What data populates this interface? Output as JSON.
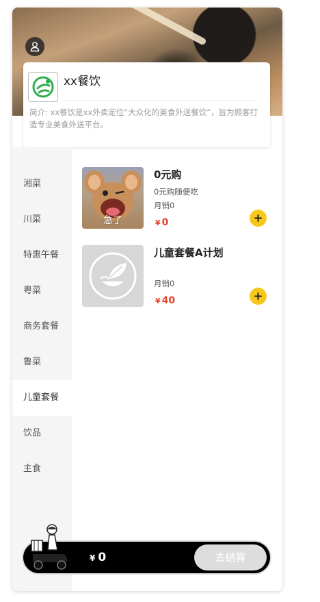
{
  "shop": {
    "name": "xx餐饮",
    "intro": "简介: xx餐饮是xx外卖定位“大众化的美食外送餐饮”，旨为顾客打造专业美食外送平台。"
  },
  "categories": [
    "湘菜",
    "川菜",
    "特惠午餐",
    "粤菜",
    "商务套餐",
    "鲁菜",
    "儿童套餐",
    "饮品",
    "主食"
  ],
  "active_category": "儿童套餐",
  "items": [
    {
      "name": "0元购",
      "desc": "0元购随便吃",
      "sales": "月销0",
      "currency": "¥",
      "price": "0",
      "image_caption": "急了"
    },
    {
      "name": "儿童套餐A计划",
      "desc": "",
      "sales": "月销0",
      "currency": "¥",
      "price": "40"
    }
  ],
  "cart": {
    "currency": "¥",
    "total": "0",
    "checkout_label": "去结算"
  },
  "colors": {
    "accent": "#f7c81b",
    "price": "#e2462f",
    "cartbar": "#000000",
    "checkout_disabled": "#dddddd"
  },
  "icons": {
    "user": "user-icon",
    "logo": "shop-logo-icon",
    "add": "plus-icon",
    "placeholder": "leaf-bowl-icon",
    "rider": "delivery-rider-icon"
  }
}
